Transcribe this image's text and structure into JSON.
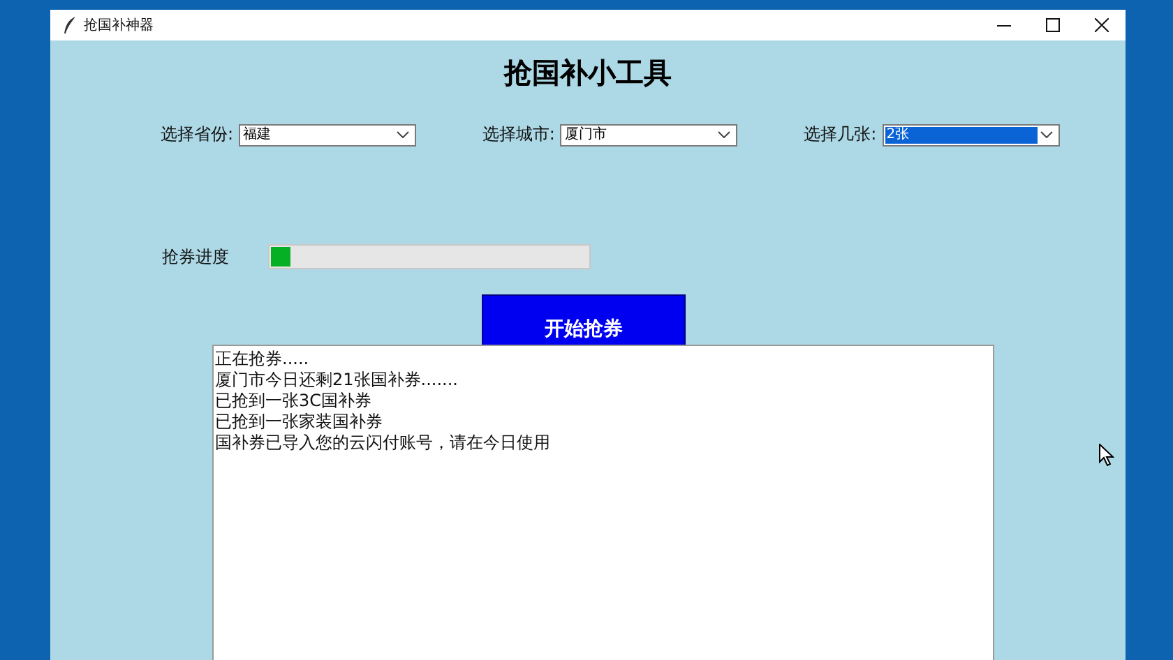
{
  "window": {
    "title": "抢国补神器",
    "heading": "抢国补小工具"
  },
  "selectors": [
    {
      "label": "选择省份:",
      "value": "福建",
      "selected": false
    },
    {
      "label": "选择城市:",
      "value": "厦门市",
      "selected": false
    },
    {
      "label": "选择几张:",
      "value": "2张",
      "selected": true
    }
  ],
  "progress": {
    "label": "抢券进度",
    "level": 0.06
  },
  "start_button": "开始抢券",
  "log": [
    "正在抢券.....",
    "厦门市今日还剩21张国补券.......",
    "已抢到一张3C国补券",
    "已抢到一张家装国补券",
    "国补券已导入您的云闪付账号，请在今日使用"
  ]
}
